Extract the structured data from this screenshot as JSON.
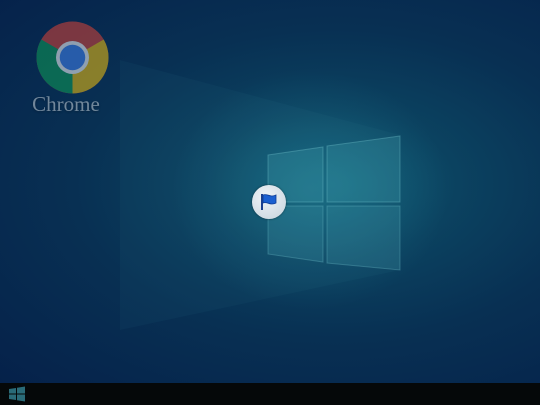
{
  "desktop": {
    "icons": [
      {
        "label": "Chrome",
        "icon": "chrome-logo-icon"
      }
    ],
    "center_badge": {
      "icon": "flag-icon",
      "color": "#1a5fd0"
    }
  },
  "taskbar": {
    "start_icon": "windows-logo-icon",
    "background": "#050809"
  },
  "colors": {
    "wallpaper_dark": "#05214a",
    "wallpaper_light": "#0f5a73"
  }
}
